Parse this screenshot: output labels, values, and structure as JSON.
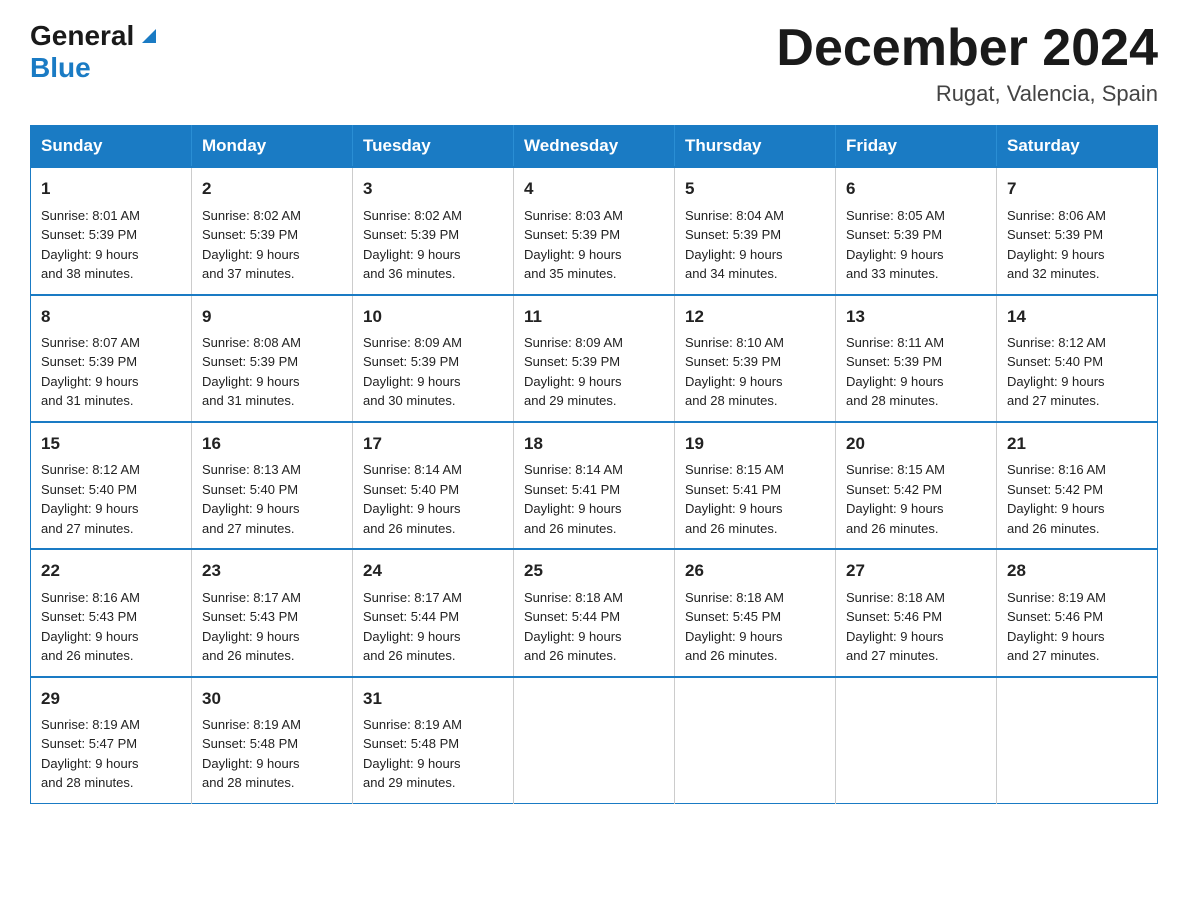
{
  "header": {
    "logo": {
      "general": "General",
      "blue": "Blue"
    },
    "title": "December 2024",
    "subtitle": "Rugat, Valencia, Spain"
  },
  "days": [
    "Sunday",
    "Monday",
    "Tuesday",
    "Wednesday",
    "Thursday",
    "Friday",
    "Saturday"
  ],
  "weeks": [
    [
      {
        "num": "1",
        "sunrise": "8:01 AM",
        "sunset": "5:39 PM",
        "daylight": "9 hours and 38 minutes."
      },
      {
        "num": "2",
        "sunrise": "8:02 AM",
        "sunset": "5:39 PM",
        "daylight": "9 hours and 37 minutes."
      },
      {
        "num": "3",
        "sunrise": "8:02 AM",
        "sunset": "5:39 PM",
        "daylight": "9 hours and 36 minutes."
      },
      {
        "num": "4",
        "sunrise": "8:03 AM",
        "sunset": "5:39 PM",
        "daylight": "9 hours and 35 minutes."
      },
      {
        "num": "5",
        "sunrise": "8:04 AM",
        "sunset": "5:39 PM",
        "daylight": "9 hours and 34 minutes."
      },
      {
        "num": "6",
        "sunrise": "8:05 AM",
        "sunset": "5:39 PM",
        "daylight": "9 hours and 33 minutes."
      },
      {
        "num": "7",
        "sunrise": "8:06 AM",
        "sunset": "5:39 PM",
        "daylight": "9 hours and 32 minutes."
      }
    ],
    [
      {
        "num": "8",
        "sunrise": "8:07 AM",
        "sunset": "5:39 PM",
        "daylight": "9 hours and 31 minutes."
      },
      {
        "num": "9",
        "sunrise": "8:08 AM",
        "sunset": "5:39 PM",
        "daylight": "9 hours and 31 minutes."
      },
      {
        "num": "10",
        "sunrise": "8:09 AM",
        "sunset": "5:39 PM",
        "daylight": "9 hours and 30 minutes."
      },
      {
        "num": "11",
        "sunrise": "8:09 AM",
        "sunset": "5:39 PM",
        "daylight": "9 hours and 29 minutes."
      },
      {
        "num": "12",
        "sunrise": "8:10 AM",
        "sunset": "5:39 PM",
        "daylight": "9 hours and 28 minutes."
      },
      {
        "num": "13",
        "sunrise": "8:11 AM",
        "sunset": "5:39 PM",
        "daylight": "9 hours and 28 minutes."
      },
      {
        "num": "14",
        "sunrise": "8:12 AM",
        "sunset": "5:40 PM",
        "daylight": "9 hours and 27 minutes."
      }
    ],
    [
      {
        "num": "15",
        "sunrise": "8:12 AM",
        "sunset": "5:40 PM",
        "daylight": "9 hours and 27 minutes."
      },
      {
        "num": "16",
        "sunrise": "8:13 AM",
        "sunset": "5:40 PM",
        "daylight": "9 hours and 27 minutes."
      },
      {
        "num": "17",
        "sunrise": "8:14 AM",
        "sunset": "5:40 PM",
        "daylight": "9 hours and 26 minutes."
      },
      {
        "num": "18",
        "sunrise": "8:14 AM",
        "sunset": "5:41 PM",
        "daylight": "9 hours and 26 minutes."
      },
      {
        "num": "19",
        "sunrise": "8:15 AM",
        "sunset": "5:41 PM",
        "daylight": "9 hours and 26 minutes."
      },
      {
        "num": "20",
        "sunrise": "8:15 AM",
        "sunset": "5:42 PM",
        "daylight": "9 hours and 26 minutes."
      },
      {
        "num": "21",
        "sunrise": "8:16 AM",
        "sunset": "5:42 PM",
        "daylight": "9 hours and 26 minutes."
      }
    ],
    [
      {
        "num": "22",
        "sunrise": "8:16 AM",
        "sunset": "5:43 PM",
        "daylight": "9 hours and 26 minutes."
      },
      {
        "num": "23",
        "sunrise": "8:17 AM",
        "sunset": "5:43 PM",
        "daylight": "9 hours and 26 minutes."
      },
      {
        "num": "24",
        "sunrise": "8:17 AM",
        "sunset": "5:44 PM",
        "daylight": "9 hours and 26 minutes."
      },
      {
        "num": "25",
        "sunrise": "8:18 AM",
        "sunset": "5:44 PM",
        "daylight": "9 hours and 26 minutes."
      },
      {
        "num": "26",
        "sunrise": "8:18 AM",
        "sunset": "5:45 PM",
        "daylight": "9 hours and 26 minutes."
      },
      {
        "num": "27",
        "sunrise": "8:18 AM",
        "sunset": "5:46 PM",
        "daylight": "9 hours and 27 minutes."
      },
      {
        "num": "28",
        "sunrise": "8:19 AM",
        "sunset": "5:46 PM",
        "daylight": "9 hours and 27 minutes."
      }
    ],
    [
      {
        "num": "29",
        "sunrise": "8:19 AM",
        "sunset": "5:47 PM",
        "daylight": "9 hours and 28 minutes."
      },
      {
        "num": "30",
        "sunrise": "8:19 AM",
        "sunset": "5:48 PM",
        "daylight": "9 hours and 28 minutes."
      },
      {
        "num": "31",
        "sunrise": "8:19 AM",
        "sunset": "5:48 PM",
        "daylight": "9 hours and 29 minutes."
      },
      null,
      null,
      null,
      null
    ]
  ],
  "labels": {
    "sunrise": "Sunrise:",
    "sunset": "Sunset:",
    "daylight": "Daylight:"
  }
}
